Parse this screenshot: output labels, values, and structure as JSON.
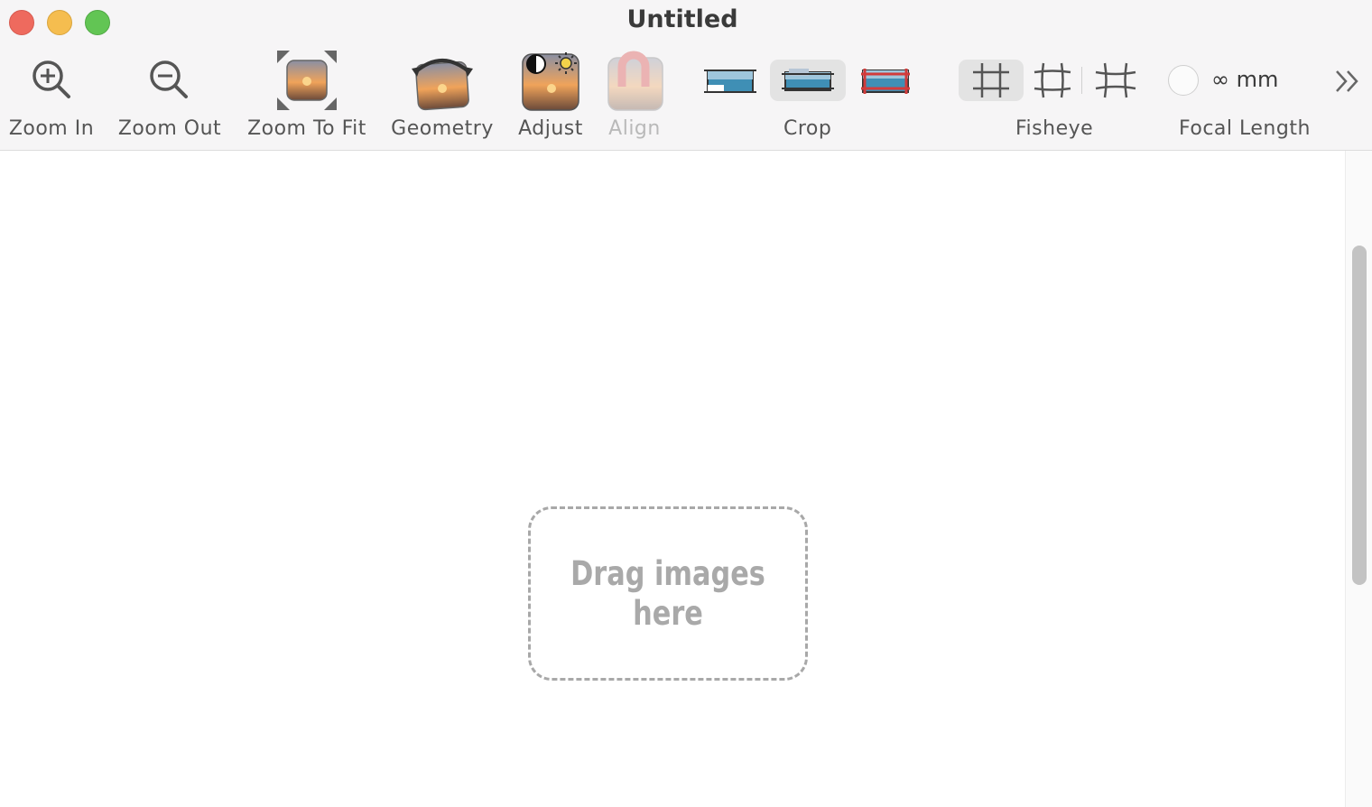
{
  "window": {
    "title": "Untitled"
  },
  "toolbar": {
    "zoom_in": "Zoom In",
    "zoom_out": "Zoom Out",
    "zoom_to_fit": "Zoom To Fit",
    "geometry": "Geometry",
    "adjust": "Adjust",
    "align": "Align",
    "crop": "Crop",
    "fisheye": "Fisheye",
    "focal_length_label": "Focal Length",
    "focal_length_value": "∞ mm",
    "selected_crop_option": 2,
    "selected_fisheye_option": 1
  },
  "canvas": {
    "drop_text_line1": "Drag images",
    "drop_text_line2": "here"
  },
  "scrollbar": {
    "visible_fraction": 0.52
  },
  "colors": {
    "close": "#ee6a5e",
    "minimize": "#f5bd4f",
    "maximize": "#62c554"
  }
}
